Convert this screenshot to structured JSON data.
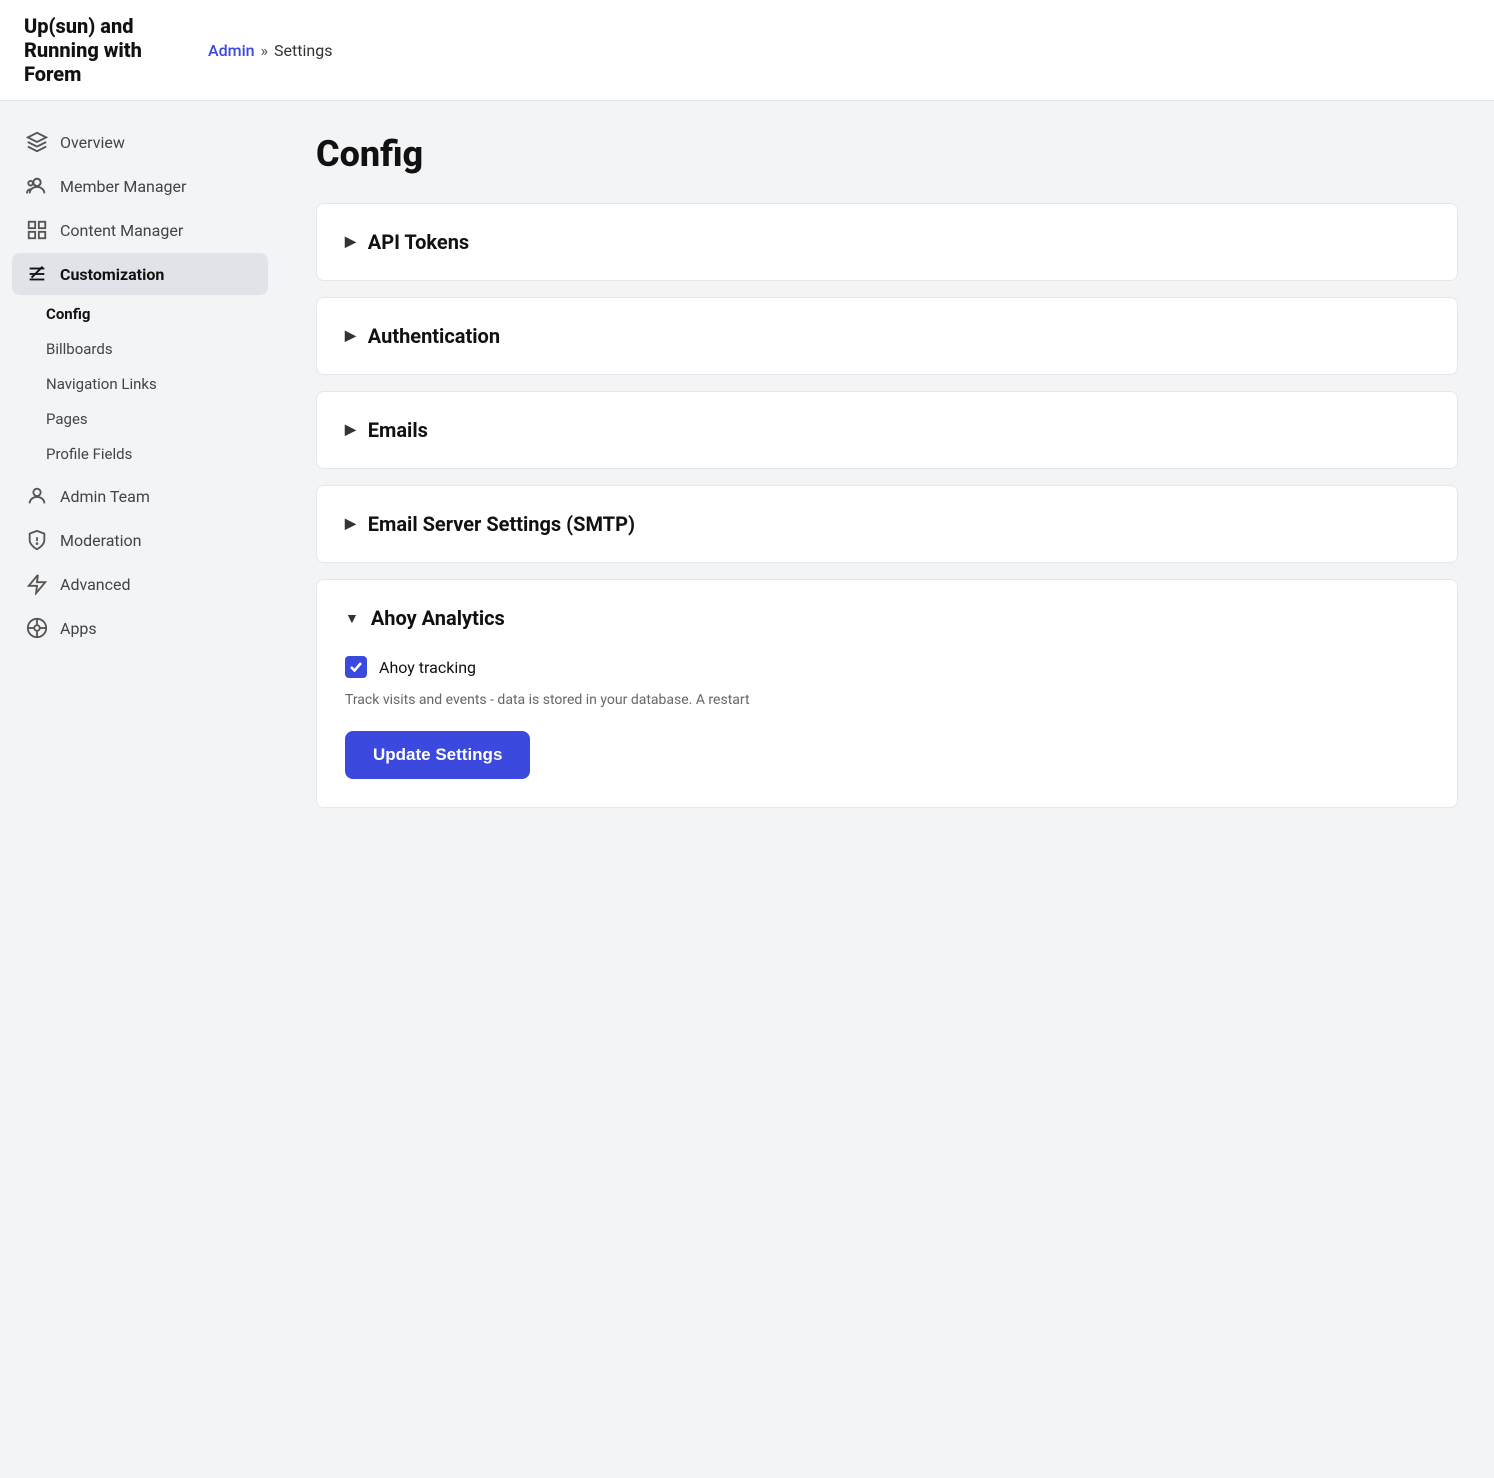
{
  "header": {
    "site_title": "Up(sun) and Running with Forem",
    "breadcrumb": {
      "admin_label": "Admin",
      "separator": "»",
      "current": "Settings"
    }
  },
  "sidebar": {
    "items": [
      {
        "id": "overview",
        "label": "Overview",
        "icon": "layers-icon",
        "active": false
      },
      {
        "id": "member-manager",
        "label": "Member Manager",
        "icon": "users-icon",
        "active": false
      },
      {
        "id": "content-manager",
        "label": "Content Manager",
        "icon": "grid-icon",
        "active": false
      },
      {
        "id": "customization",
        "label": "Customization",
        "icon": "tool-icon",
        "active": true
      }
    ],
    "sub_items": [
      {
        "id": "config",
        "label": "Config",
        "active": true
      },
      {
        "id": "billboards",
        "label": "Billboards",
        "active": false
      },
      {
        "id": "navigation-links",
        "label": "Navigation Links",
        "active": false
      },
      {
        "id": "pages",
        "label": "Pages",
        "active": false
      },
      {
        "id": "profile-fields",
        "label": "Profile Fields",
        "active": false
      }
    ],
    "bottom_items": [
      {
        "id": "admin-team",
        "label": "Admin Team",
        "icon": "person-icon"
      },
      {
        "id": "moderation",
        "label": "Moderation",
        "icon": "shield-icon"
      },
      {
        "id": "advanced",
        "label": "Advanced",
        "icon": "lightning-icon"
      },
      {
        "id": "apps",
        "label": "Apps",
        "icon": "apps-icon"
      }
    ]
  },
  "main": {
    "page_title": "Config",
    "sections": [
      {
        "id": "api-tokens",
        "label": "API Tokens",
        "expanded": false,
        "arrow": "▶"
      },
      {
        "id": "authentication",
        "label": "Authentication",
        "expanded": false,
        "arrow": "▶"
      },
      {
        "id": "emails",
        "label": "Emails",
        "expanded": false,
        "arrow": "▶"
      },
      {
        "id": "email-server",
        "label": "Email Server Settings (SMTP)",
        "expanded": false,
        "arrow": "▶"
      },
      {
        "id": "ahoy-analytics",
        "label": "Ahoy Analytics",
        "expanded": true,
        "arrow": "▼"
      }
    ],
    "ahoy_section": {
      "checkbox_label": "Ahoy tracking",
      "checkbox_checked": true,
      "description": "Track visits and events - data is stored in your database. A restart",
      "update_button": "Update Settings"
    }
  }
}
